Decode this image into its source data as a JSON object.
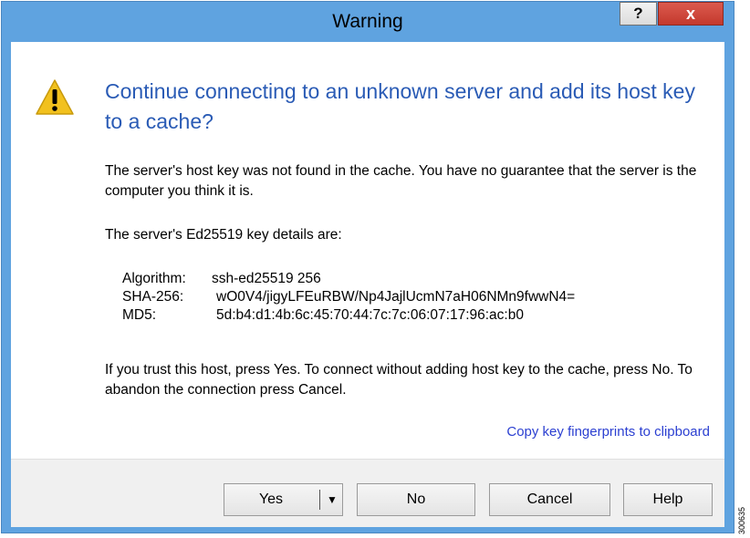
{
  "window": {
    "title": "Warning",
    "help_button": "?",
    "close_button": "x"
  },
  "dialog": {
    "heading": "Continue connecting to an unknown server and add its host key to a cache?",
    "para1": "The server's host key was not found in the cache. You have no guarantee that the server is the computer you think it is.",
    "para2": "The server's Ed25519 key details are:",
    "key_details": [
      {
        "label": "Algorithm:",
        "value": "ssh-ed25519 256"
      },
      {
        "label": "SHA-256:",
        "value": "wO0V4/jigyLFEuRBW/Np4JajlUcmN7aH06NMn9fwwN4="
      },
      {
        "label": "MD5:",
        "value": "5d:b4:d1:4b:6c:45:70:44:7c:7c:06:07:17:96:ac:b0"
      }
    ],
    "para3": "If you trust this host, press Yes. To connect without adding host key to the cache, press No. To abandon the connection press Cancel.",
    "copy_link": "Copy key fingerprints to clipboard"
  },
  "buttons": {
    "yes": "Yes",
    "no": "No",
    "cancel": "Cancel",
    "help": "Help"
  },
  "side_label": "300635",
  "colors": {
    "title_bar": "#5fa3e0",
    "heading": "#2a5bb5",
    "link": "#2b3fd1",
    "close": "#c4392d"
  }
}
